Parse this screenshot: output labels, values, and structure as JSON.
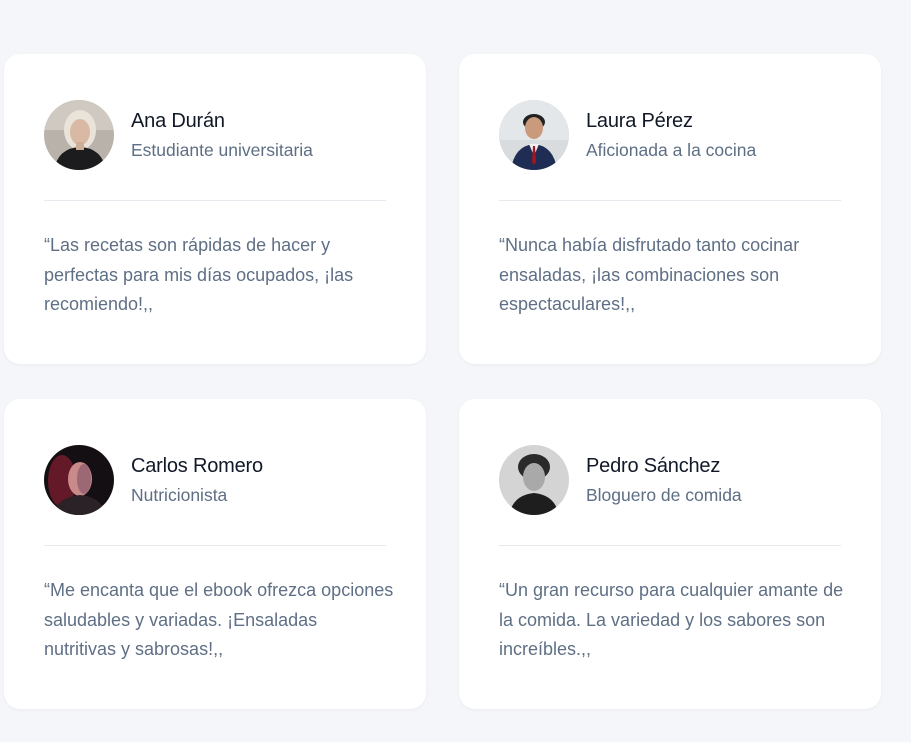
{
  "testimonials": [
    {
      "name": "Ana Durán",
      "role": "Estudiante universitaria",
      "quote": "“Las recetas son rápidas de hacer y perfectas para mis días ocupados, ¡las recomiendo!,,"
    },
    {
      "name": "Laura Pérez",
      "role": "Aficionada a la cocina",
      "quote": "“Nunca había disfrutado tanto cocinar ensaladas, ¡las combinaciones son espectaculares!,,"
    },
    {
      "name": "Carlos Romero",
      "role": "Nutricionista",
      "quote": "“Me encanta que el ebook ofrezca opciones saludables y variadas. ¡Ensaladas nutritivas y sabrosas!,,"
    },
    {
      "name": "Pedro Sánchez",
      "role": "Bloguero de comida",
      "quote": "“Un gran recurso para cualquier amante de la comida. La variedad y los sabores son increíbles.,,"
    }
  ]
}
